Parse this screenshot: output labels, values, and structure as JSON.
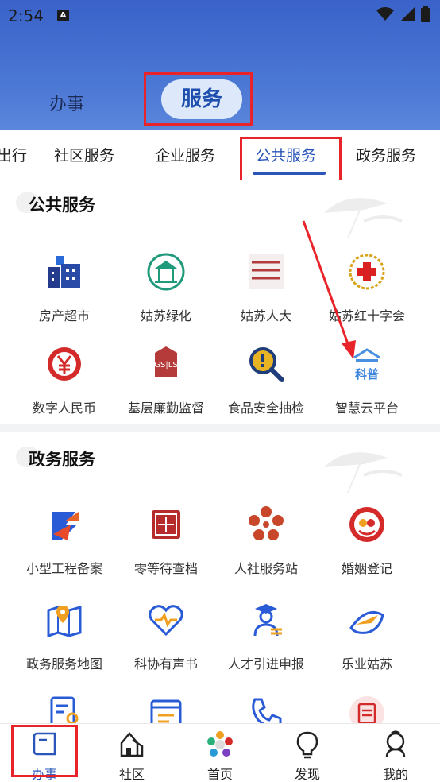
{
  "status_bar": {
    "time": "2:54",
    "notif_icon": "A"
  },
  "top_tabs": [
    {
      "label": "办事"
    },
    {
      "label": "服务"
    }
  ],
  "categories": [
    {
      "label": "出行"
    },
    {
      "label": "社区服务"
    },
    {
      "label": "企业服务"
    },
    {
      "label": "公共服务"
    },
    {
      "label": "政务服务"
    }
  ],
  "sections": [
    {
      "title": "公共服务",
      "items": [
        {
          "label": "房产超市",
          "icon": "buildings-icon"
        },
        {
          "label": "姑苏绿化",
          "icon": "pavilion-icon"
        },
        {
          "label": "姑苏人大",
          "icon": "digital-npc-icon"
        },
        {
          "label": "姑苏红十字会",
          "icon": "red-cross-icon"
        },
        {
          "label": "数字人民币",
          "icon": "digital-rmb-icon"
        },
        {
          "label": "基层廉勤监督",
          "icon": "seal-icon"
        },
        {
          "label": "食品安全抽检",
          "icon": "magnifier-icon"
        },
        {
          "label": "智慧云平台",
          "icon": "kepu-icon"
        }
      ]
    },
    {
      "title": "政务服务",
      "items": [
        {
          "label": "小型工程备案",
          "icon": "project-filing-icon"
        },
        {
          "label": "零等待查档",
          "icon": "archive-icon"
        },
        {
          "label": "人社服务站",
          "icon": "flower-icon"
        },
        {
          "label": "婚姻登记",
          "icon": "marriage-icon"
        },
        {
          "label": "政务服务地图",
          "icon": "map-icon"
        },
        {
          "label": "科协有声书",
          "icon": "heart-pulse-icon"
        },
        {
          "label": "人才引进申报",
          "icon": "graduate-icon"
        },
        {
          "label": "乐业姑苏",
          "icon": "plane-icon"
        }
      ]
    }
  ],
  "bottom_nav": [
    {
      "label": "办事",
      "icon": "book-icon"
    },
    {
      "label": "社区",
      "icon": "community-icon"
    },
    {
      "label": "首页",
      "icon": "home-flower-icon"
    },
    {
      "label": "发现",
      "icon": "bulb-icon"
    },
    {
      "label": "我的",
      "icon": "user-icon"
    }
  ],
  "colors": {
    "header_blue": "#3a62c9",
    "accent": "#2b56b9",
    "highlight_red": "#e8232a"
  }
}
